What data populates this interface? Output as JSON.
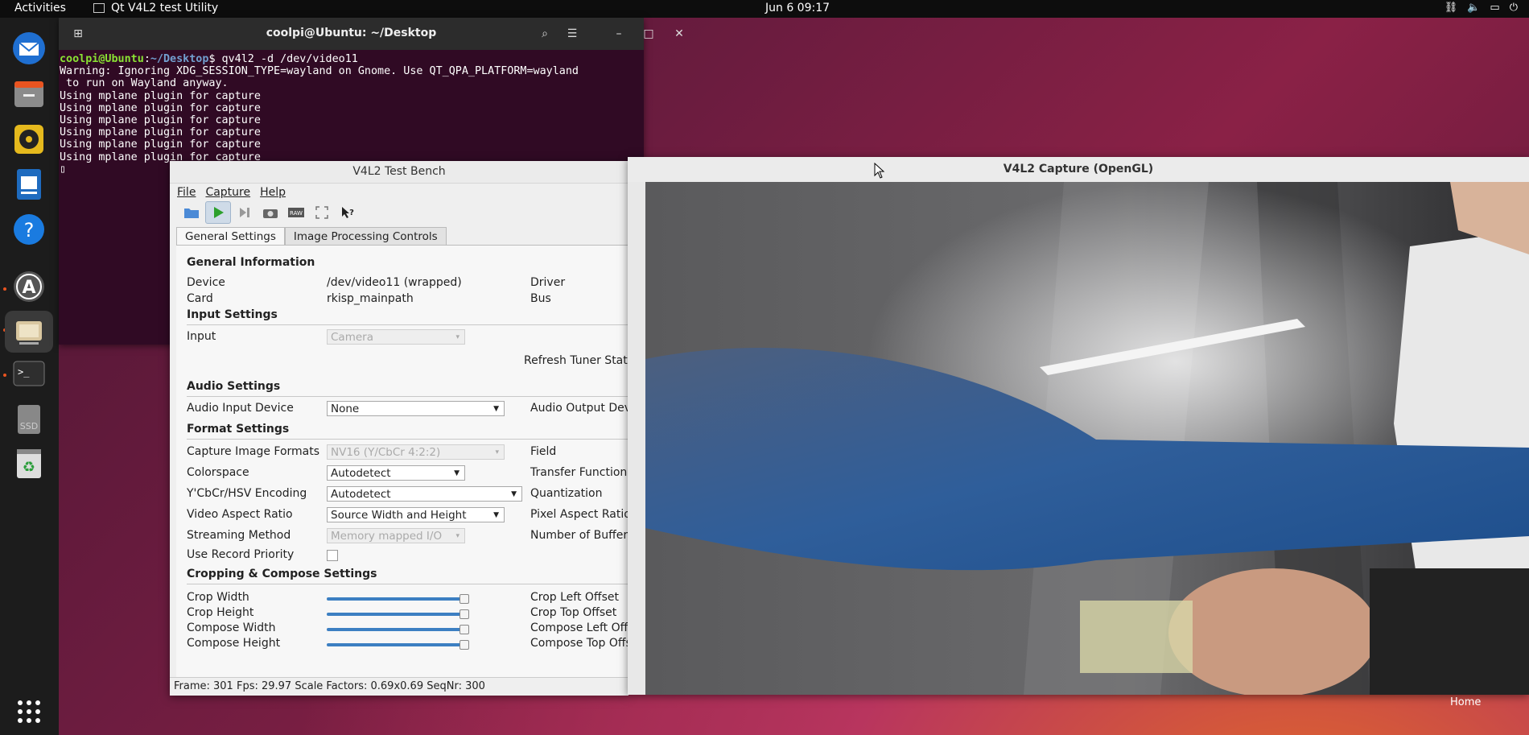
{
  "topbar": {
    "activities": "Activities",
    "app_name": "Qt V4L2 test Utility",
    "clock": "Jun 6  09:17"
  },
  "dock": {
    "items": [
      "thunderbird-icon",
      "files-icon",
      "rhythmbox-icon",
      "writer-icon",
      "help-icon",
      "software-icon",
      "qv4l2-icon",
      "terminal-icon",
      "ssd-icon",
      "trash-icon"
    ],
    "apps_grid_icon": "apps-grid-icon"
  },
  "terminal": {
    "title": "coolpi@Ubuntu: ~/Desktop",
    "prompt_user": "coolpi@Ubuntu",
    "prompt_sep": ":",
    "prompt_path": "~/Desktop",
    "prompt_cmd": "$ qv4l2 -d /dev/video11",
    "lines": [
      "Warning: Ignoring XDG_SESSION_TYPE=wayland on Gnome. Use QT_QPA_PLATFORM=wayland",
      " to run on Wayland anyway.",
      "Using mplane plugin for capture",
      "Using mplane plugin for capture",
      "Using mplane plugin for capture",
      "Using mplane plugin for capture",
      "Using mplane plugin for capture",
      "Using mplane plugin for capture"
    ]
  },
  "bench": {
    "title": "V4L2 Test Bench",
    "menu": [
      "File",
      "Capture",
      "Help"
    ],
    "tabs": [
      "General Settings",
      "Image Processing Controls"
    ],
    "sections": {
      "general": "General Information",
      "input": "Input Settings",
      "audio": "Audio Settings",
      "format": "Format Settings",
      "crop": "Cropping & Compose Settings"
    },
    "labels": {
      "device": "Device",
      "device_val": "/dev/video11 (wrapped)",
      "driver": "Driver",
      "card": "Card",
      "card_val": "rkisp_mainpath",
      "bus": "Bus",
      "input": "Input",
      "input_val": "Camera",
      "refresh": "Refresh Tuner Status",
      "audio_in": "Audio Input Device",
      "audio_in_val": "None",
      "audio_out": "Audio Output Devi",
      "cap_formats": "Capture Image Formats",
      "cap_formats_val": "NV16 (Y/CbCr 4:2:2)",
      "field": "Field",
      "colorspace": "Colorspace",
      "colorspace_val": "Autodetect",
      "transfer": "Transfer Function",
      "encoding": "Y'CbCr/HSV Encoding",
      "encoding_val": "Autodetect",
      "quant": "Quantization",
      "aspect": "Video Aspect Ratio",
      "aspect_val": "Source Width and Height",
      "pixel_aspect": "Pixel Aspect Ratio",
      "streaming": "Streaming Method",
      "streaming_val": "Memory mapped I/O",
      "buffers": "Number of Buffers",
      "record": "Use Record Priority",
      "crop_w": "Crop Width",
      "crop_h": "Crop Height",
      "comp_w": "Compose Width",
      "comp_h": "Compose Height",
      "crop_left": "Crop Left Offset",
      "crop_top": "Crop Top Offset",
      "comp_left": "Compose Left Offs",
      "comp_top": "Compose Top Offse"
    },
    "sliders": {
      "crop_width": 1.0,
      "crop_height": 1.0,
      "compose_width": 1.0,
      "compose_height": 1.0
    },
    "status": "Frame: 301 Fps: 29.97 Scale Factors: 0.69x0.69 SeqNr: 300"
  },
  "capture": {
    "title": "V4L2 Capture (OpenGL)"
  },
  "desktop": {
    "home_label": "Home"
  }
}
